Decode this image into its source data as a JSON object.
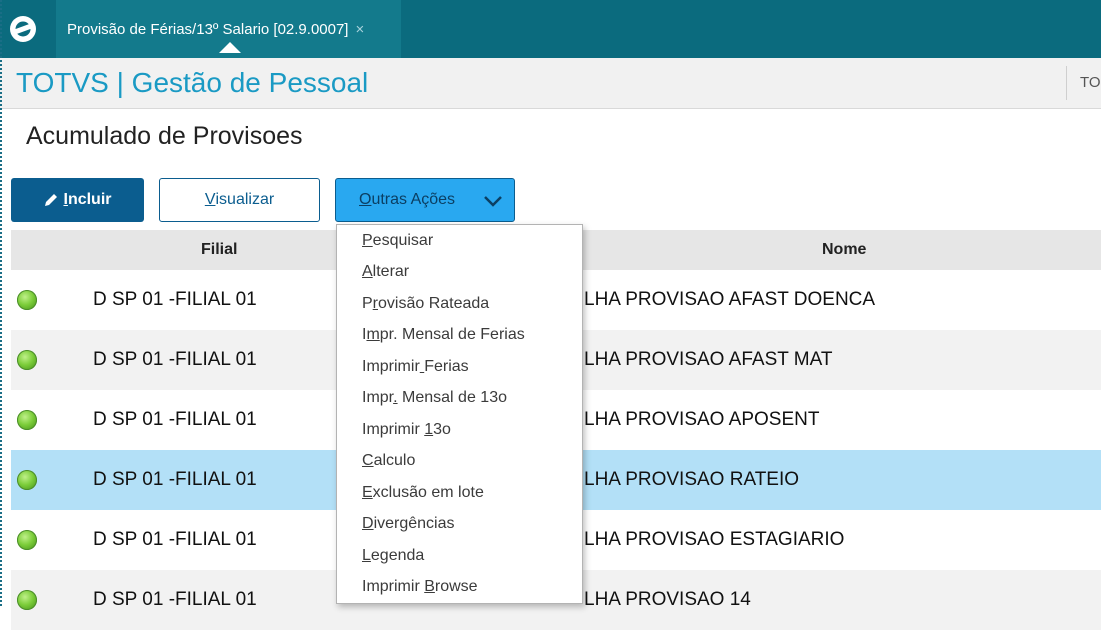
{
  "colors": {
    "topbar": "#0b6b7e",
    "tab_active": "#137a8c",
    "app_title": "#1a9ac4",
    "primary_button": "#0b5d8f",
    "dropdown_button": "#29a8f0",
    "selected_row": "#b3e0f7",
    "status_green": "#7ccd3a"
  },
  "tabbar": {
    "logo_icon": "totvs-logo-icon",
    "tab": {
      "label": "Provisão de Férias/13º Salario [02.9.0007]",
      "close": "×"
    }
  },
  "app": {
    "title": "TOTVS | Gestão de Pessoal",
    "user_truncated": "TO"
  },
  "page": {
    "title": "Acumulado de Provisoes"
  },
  "toolbar": {
    "incluir": {
      "accel": "I",
      "rest": "ncluir",
      "icon": "pencil-icon"
    },
    "visualizar": {
      "accel": "V",
      "rest": "isualizar"
    },
    "outras": {
      "accel": "O",
      "rest": "utras Ações",
      "icon": "chevron-down-icon"
    }
  },
  "table": {
    "headers": {
      "filial": "Filial",
      "nome": "Nome"
    },
    "rows": [
      {
        "status": "green",
        "filial": "D SP 01 -FILIAL 01",
        "nome": "LHA PROVISAO AFAST DOENCA"
      },
      {
        "status": "green",
        "filial": "D SP 01 -FILIAL 01",
        "nome": "LHA PROVISAO AFAST MAT"
      },
      {
        "status": "green",
        "filial": "D SP 01 -FILIAL 01",
        "nome": "LHA PROVISAO APOSENT"
      },
      {
        "status": "green",
        "filial": "D SP 01 -FILIAL 01",
        "nome": "LHA PROVISAO RATEIO",
        "selected": true
      },
      {
        "status": "green",
        "filial": "D SP 01 -FILIAL 01",
        "nome": "LHA PROVISAO ESTAGIARIO"
      },
      {
        "status": "green",
        "filial": "D SP 01 -FILIAL 01",
        "nome": "LHA PROVISAO 14"
      }
    ]
  },
  "menu": {
    "items": [
      {
        "pre": "",
        "accel": "P",
        "post": "esquisar"
      },
      {
        "pre": "",
        "accel": "A",
        "post": "lterar"
      },
      {
        "pre": "P",
        "accel": "r",
        "post": "ovisão Rateada"
      },
      {
        "pre": "I",
        "accel": "m",
        "post": "pr. Mensal de Ferias"
      },
      {
        "pre": "Imprimir",
        "accel": " ",
        "post": "Ferias"
      },
      {
        "pre": "Impr",
        "accel": ".",
        "post": " Mensal de 13o"
      },
      {
        "pre": "Imprimir ",
        "accel": "1",
        "post": "3o"
      },
      {
        "pre": "",
        "accel": "C",
        "post": "alculo"
      },
      {
        "pre": "",
        "accel": "E",
        "post": "xclusão em lote"
      },
      {
        "pre": "",
        "accel": "D",
        "post": "ivergências"
      },
      {
        "pre": "",
        "accel": "L",
        "post": "egenda"
      },
      {
        "pre": "Imprimir ",
        "accel": "B",
        "post": "rowse"
      }
    ]
  }
}
